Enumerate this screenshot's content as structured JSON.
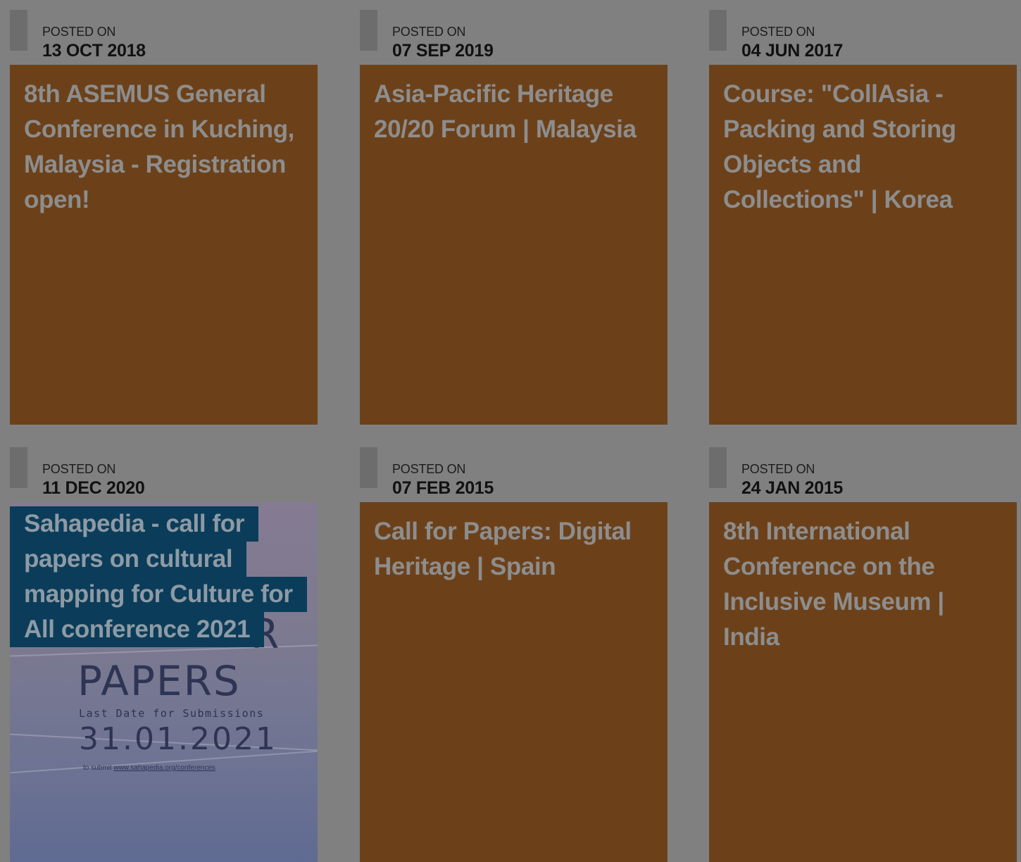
{
  "meta_label": "POSTED ON",
  "colors": {
    "background": "#808080",
    "card": "#6c411a",
    "card_title": "#8d8d8d",
    "highlight": "#0b3d5a"
  },
  "posts": [
    {
      "date": "13 OCT 2018",
      "title": "8th ASEMUS General Conference in Kuching, Malaysia - Registration open!"
    },
    {
      "date": "07 SEP 2019",
      "title": "Asia-Pacific Heritage 20/20 Forum | Malaysia"
    },
    {
      "date": "04 JUN 2017",
      "title": "Course: \"CollAsia - Packing and Storing Objects and Collections\" | Korea"
    },
    {
      "date": "11 DEC 2020",
      "title_lines": [
        "Sahapedia - call for",
        "papers on cultural",
        "mapping for Culture for",
        "All conference 2021"
      ],
      "poster": {
        "heading_end": "R",
        "heading": "PAPERS",
        "last_date_label": "Last Date for Submissions",
        "last_date": "31.01.2021",
        "submit_prefix": "to submit",
        "submit_link": "www.sahapedia.org/conferences"
      }
    },
    {
      "date": "07 FEB 2015",
      "title": "Call for Papers: Digital Heritage | Spain"
    },
    {
      "date": "24 JAN 2015",
      "title": "8th International Conference on the Inclusive Museum | India"
    }
  ]
}
